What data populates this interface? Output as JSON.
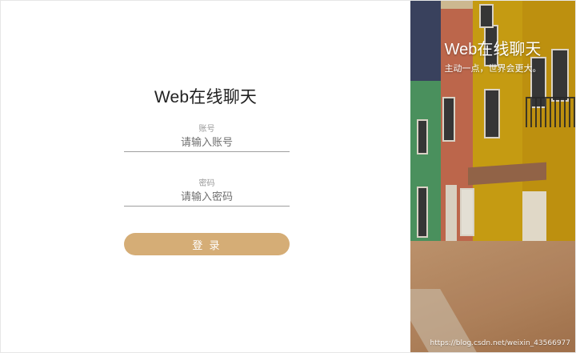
{
  "login": {
    "title": "Web在线聊天",
    "account": {
      "label": "账号",
      "value": "",
      "placeholder": "请输入账号"
    },
    "password": {
      "label": "密码",
      "value": "",
      "placeholder": "请输入密码"
    },
    "submit_label": "登 录"
  },
  "banner": {
    "title": "Web在线聊天",
    "slogan": "主动一点，世界会更大。"
  },
  "watermark": "https://blog.csdn.net/weixin_43566977",
  "colors": {
    "accent": "#d5ad76",
    "input_underline": "#9f9f9f",
    "label": "#9a9a9a"
  }
}
